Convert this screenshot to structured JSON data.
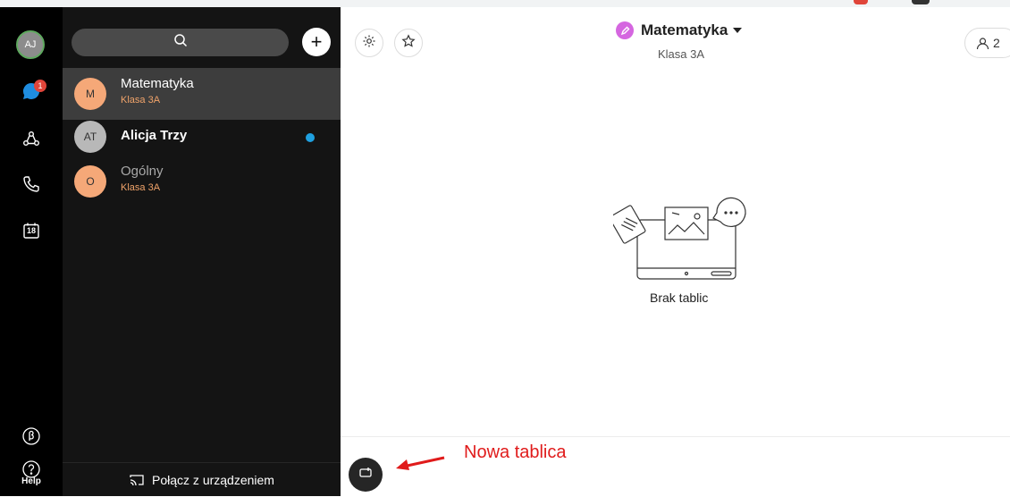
{
  "user": {
    "initials": "AJ",
    "unread_count": "1"
  },
  "rail": {
    "icons": [
      "messaging-icon",
      "teams-icon",
      "calls-icon",
      "calendar-icon",
      "beta-icon",
      "help-icon"
    ],
    "calendar_day": "18",
    "help_label": "Help"
  },
  "spaces": [
    {
      "initials": "M",
      "name": "Matematyka",
      "subtitle": "Klasa 3A",
      "avatar_color": "#f5a878",
      "active": true
    },
    {
      "initials": "AT",
      "name": "Alicja Trzy",
      "subtitle": "",
      "avatar_color": "#b8b8b8",
      "unread": true
    },
    {
      "initials": "O",
      "name": "Ogólny",
      "subtitle": "Klasa 3A",
      "avatar_color": "#f5a878"
    }
  ],
  "connect_label": "Połącz z urządzeniem",
  "header": {
    "title": "Matematyka",
    "subtitle": "Klasa 3A",
    "member_count": "2",
    "title_dot_color": "#d566e0"
  },
  "empty_state": {
    "label": "Brak tablic"
  },
  "annotation": {
    "text": "Nowa tablica",
    "color": "#e01b1b"
  },
  "colors": {
    "unread_dot": "#1fa0e0",
    "badge": "#e0453a",
    "accent_sub": "#f0a36a"
  }
}
